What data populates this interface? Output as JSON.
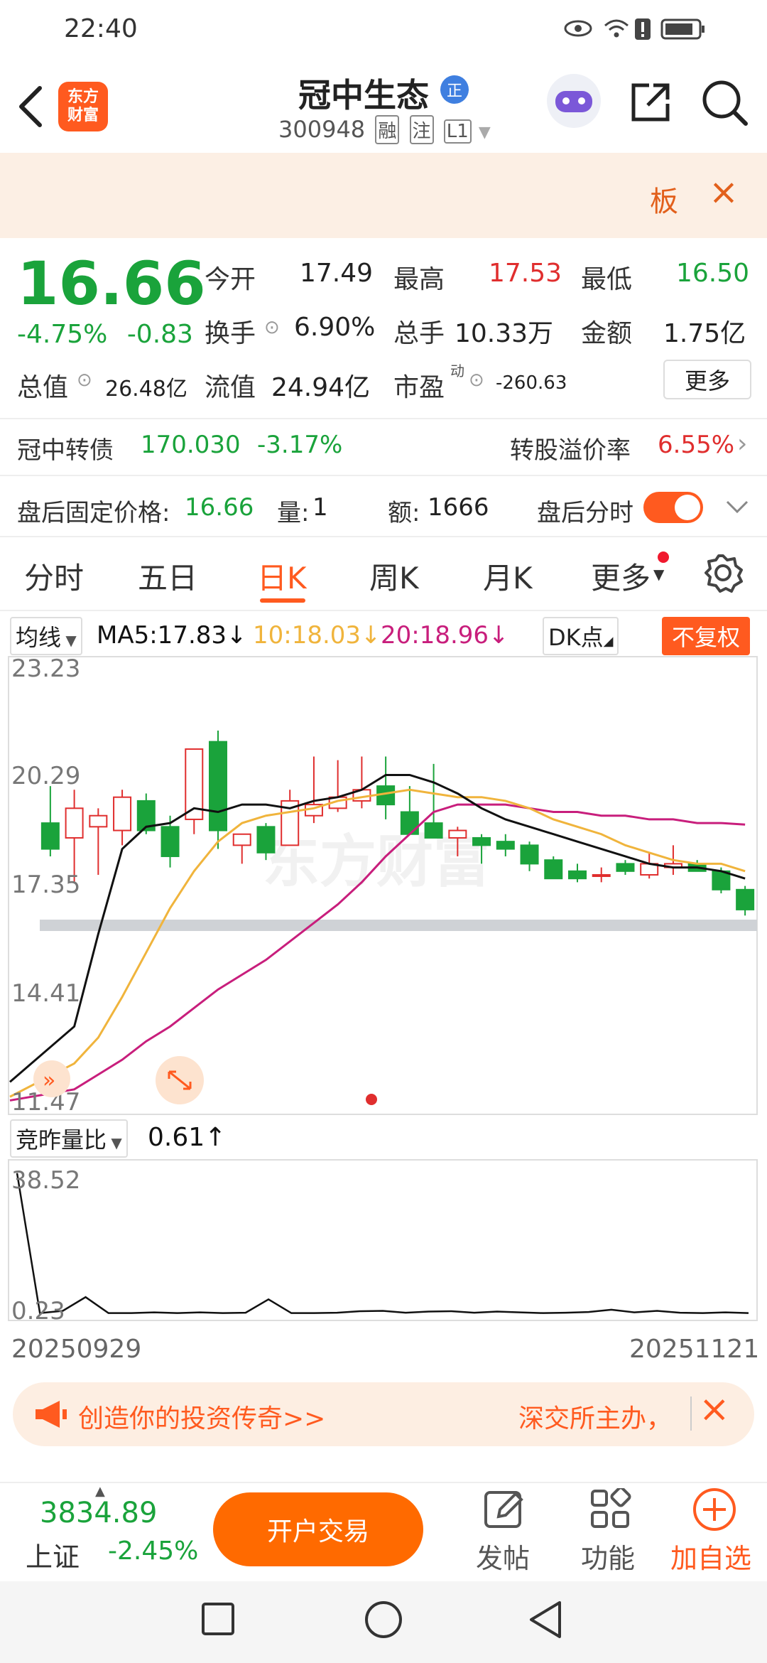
{
  "status_bar": {
    "time": "22:40"
  },
  "header": {
    "logo_line1": "东方",
    "logo_line2": "财富",
    "title": "冠中生态",
    "badge": "正",
    "code": "300948",
    "tags": [
      "融",
      "注",
      "L1"
    ]
  },
  "banner": {
    "board_label": "板",
    "close": "×"
  },
  "quote": {
    "price": "16.66",
    "change_pct": "-4.75%",
    "change_abs": "-0.83",
    "open_label": "今开",
    "open": "17.49",
    "high_label": "最高",
    "high": "17.53",
    "low_label": "最低",
    "low": "16.50",
    "turnover_label": "换手",
    "turnover": "6.90%",
    "volume_label": "总手",
    "volume": "10.33万",
    "amount_label": "金额",
    "amount": "1.75亿",
    "mktcap_label": "总值",
    "mktcap": "26.48亿",
    "float_label": "流值",
    "float": "24.94亿",
    "pe_label": "市盈",
    "pe_sup": "动",
    "pe": "-260.63",
    "more": "更多"
  },
  "bond": {
    "name": "冠中转债",
    "price": "170.030",
    "pct": "-3.17%",
    "premium_label": "转股溢价率",
    "premium": "6.55%"
  },
  "afterhours": {
    "price_label": "盘后固定价格:",
    "price": "16.66",
    "qty_label": "量:",
    "qty": "1",
    "amt_label": "额:",
    "amt": "1666",
    "toggle_label": "盘后分时"
  },
  "tabs": [
    "分时",
    "五日",
    "日K",
    "周K",
    "月K",
    "更多"
  ],
  "ma_bar": {
    "ma_select": "均线",
    "ma5": "MA5:17.83↓",
    "ma10": "10:18.03↓",
    "ma20": "20:18.96↓",
    "dk": "DK点",
    "adjust": "不复权"
  },
  "colors": {
    "up": "#e02e2e",
    "down": "#1aa33b",
    "accent": "#ff5a1f",
    "ma5": "#111111",
    "ma10": "#f0b43c",
    "ma20": "#c81e7c"
  },
  "chart_data": [
    {
      "type": "candlestick",
      "y_ticks": [
        "23.23",
        "20.29",
        "17.35",
        "14.41",
        "11.47"
      ],
      "ylim": [
        11.47,
        23.23
      ],
      "x_start": "20250929",
      "x_end": "20251121",
      "watermark": "东方财富",
      "candles": [
        {
          "o": 19.0,
          "h": 20.0,
          "l": 18.1,
          "c": 18.3
        },
        {
          "o": 18.6,
          "h": 19.9,
          "l": 17.4,
          "c": 19.4
        },
        {
          "o": 18.9,
          "h": 19.4,
          "l": 17.6,
          "c": 19.2
        },
        {
          "o": 18.8,
          "h": 19.9,
          "l": 18.4,
          "c": 19.7
        },
        {
          "o": 19.6,
          "h": 19.8,
          "l": 18.7,
          "c": 18.8
        },
        {
          "o": 18.9,
          "h": 19.2,
          "l": 17.8,
          "c": 18.1
        },
        {
          "o": 19.1,
          "h": 21.0,
          "l": 18.7,
          "c": 21.0
        },
        {
          "o": 21.2,
          "h": 21.5,
          "l": 18.3,
          "c": 18.8
        },
        {
          "o": 18.4,
          "h": 18.7,
          "l": 17.9,
          "c": 18.7
        },
        {
          "o": 18.9,
          "h": 19.0,
          "l": 18.0,
          "c": 18.2
        },
        {
          "o": 18.4,
          "h": 19.9,
          "l": 18.4,
          "c": 19.6
        },
        {
          "o": 19.2,
          "h": 20.8,
          "l": 19.0,
          "c": 19.5
        },
        {
          "o": 19.4,
          "h": 20.7,
          "l": 19.3,
          "c": 19.7
        },
        {
          "o": 19.6,
          "h": 20.8,
          "l": 19.4,
          "c": 19.9
        },
        {
          "o": 20.0,
          "h": 20.8,
          "l": 19.1,
          "c": 19.5
        },
        {
          "o": 19.3,
          "h": 20.0,
          "l": 18.9,
          "c": 18.7
        },
        {
          "o": 19.0,
          "h": 20.6,
          "l": 18.7,
          "c": 18.6
        },
        {
          "o": 18.6,
          "h": 18.9,
          "l": 18.1,
          "c": 18.8
        },
        {
          "o": 18.6,
          "h": 18.7,
          "l": 17.9,
          "c": 18.4
        },
        {
          "o": 18.5,
          "h": 18.7,
          "l": 18.1,
          "c": 18.3
        },
        {
          "o": 18.4,
          "h": 18.5,
          "l": 17.7,
          "c": 17.9
        },
        {
          "o": 18.0,
          "h": 18.1,
          "l": 17.6,
          "c": 17.5
        },
        {
          "o": 17.7,
          "h": 17.9,
          "l": 17.4,
          "c": 17.5
        },
        {
          "o": 17.6,
          "h": 17.8,
          "l": 17.4,
          "c": 17.6
        },
        {
          "o": 17.9,
          "h": 18.0,
          "l": 17.6,
          "c": 17.7
        },
        {
          "o": 17.6,
          "h": 18.2,
          "l": 17.5,
          "c": 17.9
        },
        {
          "o": 17.8,
          "h": 18.4,
          "l": 17.6,
          "c": 17.9
        },
        {
          "o": 17.9,
          "h": 18.0,
          "l": 17.7,
          "c": 17.7
        },
        {
          "o": 17.7,
          "h": 17.8,
          "l": 17.1,
          "c": 17.2
        },
        {
          "o": 17.2,
          "h": 17.3,
          "l": 16.5,
          "c": 16.66
        }
      ],
      "ma5": [
        12.0,
        13.5,
        16.0,
        18.3,
        18.9,
        19.0,
        19.4,
        19.3,
        19.5,
        19.5,
        19.4,
        19.6,
        19.7,
        19.9,
        20.3,
        20.3,
        20.1,
        19.8,
        19.4,
        19.1,
        18.9,
        18.7,
        18.5,
        18.3,
        18.1,
        17.9,
        17.8,
        17.8,
        17.7,
        17.5
      ],
      "ma10": [
        11.6,
        12.5,
        13.2,
        14.3,
        15.5,
        16.7,
        17.7,
        18.5,
        19.0,
        19.2,
        19.3,
        19.4,
        19.6,
        19.7,
        19.8,
        19.9,
        19.8,
        19.7,
        19.7,
        19.6,
        19.4,
        19.1,
        18.9,
        18.7,
        18.4,
        18.2,
        18.0,
        17.9,
        17.9,
        17.7
      ],
      "ma20": [
        11.5,
        11.8,
        12.2,
        12.6,
        13.1,
        13.5,
        14.0,
        14.5,
        14.9,
        15.3,
        15.8,
        16.3,
        16.8,
        17.4,
        18.1,
        18.7,
        19.3,
        19.5,
        19.5,
        19.5,
        19.4,
        19.3,
        19.3,
        19.2,
        19.2,
        19.1,
        19.1,
        19.0,
        19.0,
        18.96
      ]
    },
    {
      "type": "line",
      "title": "竞昨量比",
      "value": "0.61↑",
      "y_ticks": [
        "38.52",
        "0.23"
      ],
      "ylim": [
        0.23,
        38.52
      ],
      "values": [
        38.0,
        0.3,
        0.9,
        4.6,
        0.3,
        0.3,
        0.5,
        0.3,
        0.5,
        0.3,
        0.4,
        4.0,
        0.3,
        0.3,
        0.4,
        0.8,
        0.9,
        0.4,
        0.7,
        0.8,
        0.4,
        0.7,
        0.5,
        0.3,
        0.4,
        0.6,
        1.2,
        0.5,
        0.9,
        0.4,
        0.3,
        0.5,
        0.3
      ]
    }
  ],
  "adbar": {
    "text_left": "创造你的投资传奇>>",
    "text_right": "深交所主办，",
    "close": "×"
  },
  "bottom": {
    "index_value": "3834.89",
    "index_name": "上证",
    "index_pct": "-2.45%",
    "open_account": "开户交易",
    "post": "发帖",
    "function": "功能",
    "add_watch": "加自选"
  }
}
